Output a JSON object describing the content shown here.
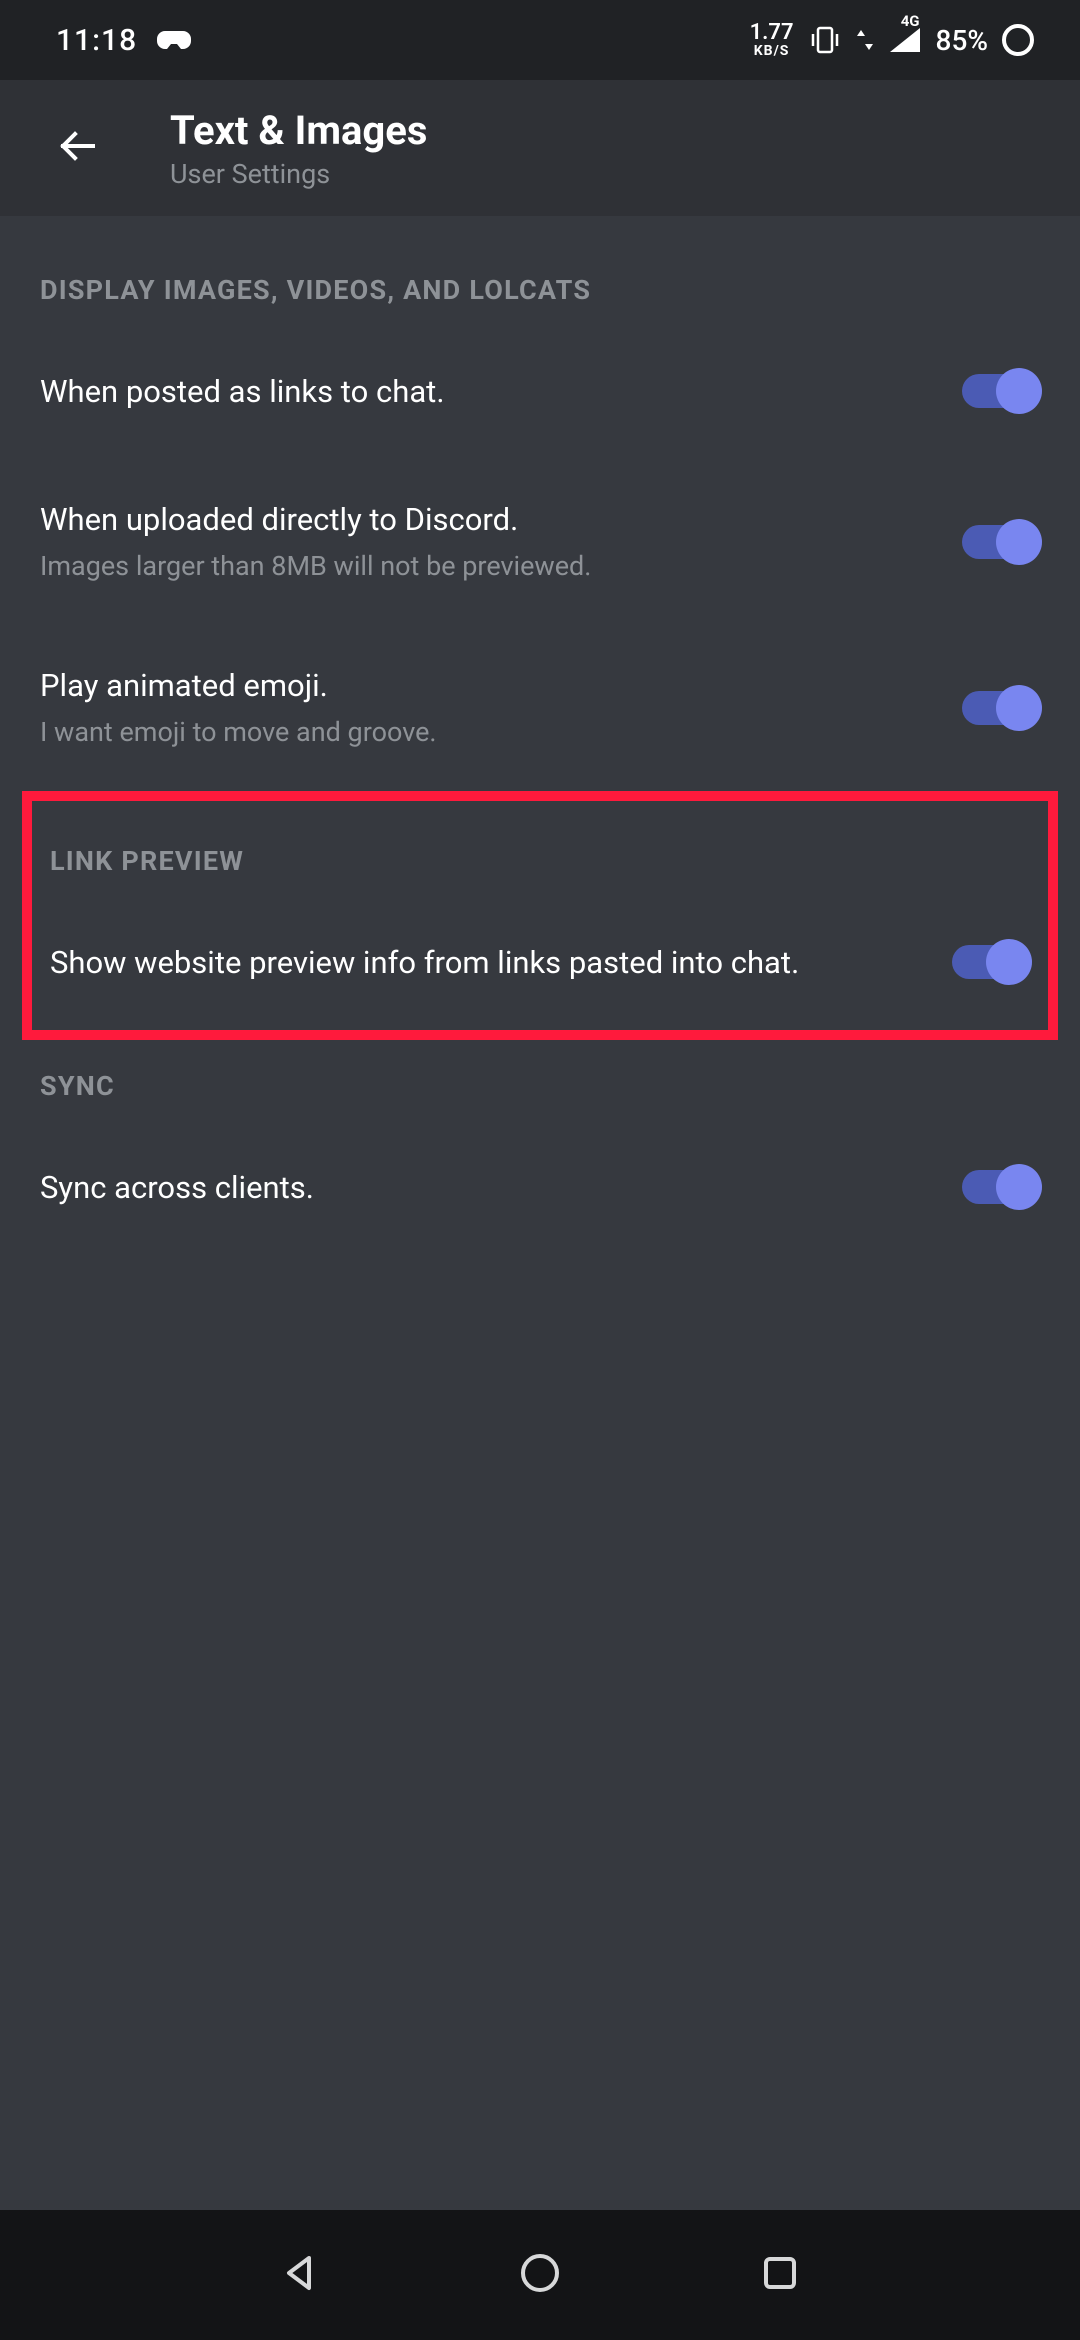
{
  "status_bar": {
    "time": "11:18",
    "net_speed_value": "1.77",
    "net_speed_unit": "KB/S",
    "network_label": "4G",
    "battery_percent": "85%"
  },
  "header": {
    "title": "Text & Images",
    "subtitle": "User Settings"
  },
  "sections": {
    "display_images": {
      "header": "DISPLAY IMAGES, VIDEOS, AND LOLCATS",
      "items": [
        {
          "title": "When posted as links to chat.",
          "desc": null,
          "on": true
        },
        {
          "title": "When uploaded directly to Discord.",
          "desc": "Images larger than 8MB will not be previewed.",
          "on": true
        },
        {
          "title": "Play animated emoji.",
          "desc": "I want emoji to move and groove.",
          "on": true
        }
      ]
    },
    "link_preview": {
      "header": "LINK PREVIEW",
      "items": [
        {
          "title": "Show website preview info from links pasted into chat.",
          "desc": null,
          "on": true
        }
      ]
    },
    "sync": {
      "header": "SYNC",
      "items": [
        {
          "title": "Sync across clients.",
          "desc": null,
          "on": true
        }
      ]
    }
  },
  "colors": {
    "highlight_border": "#ff1a3c",
    "toggle_on_thumb": "#7986f0",
    "toggle_on_track": "#4b5bb4",
    "bg_main": "#36393f",
    "bg_header": "#2f3136",
    "bg_status": "#202225",
    "text_secondary": "#8e9297"
  },
  "icons": {
    "game_controller": "game-controller-icon",
    "vibrate": "vibrate-icon",
    "signal": "signal-icon",
    "battery_ring": "battery-activity-ring-icon",
    "back": "arrow-left-icon",
    "nav_back": "triangle-back-icon",
    "nav_home": "circle-home-icon",
    "nav_recent": "square-recent-icon"
  }
}
